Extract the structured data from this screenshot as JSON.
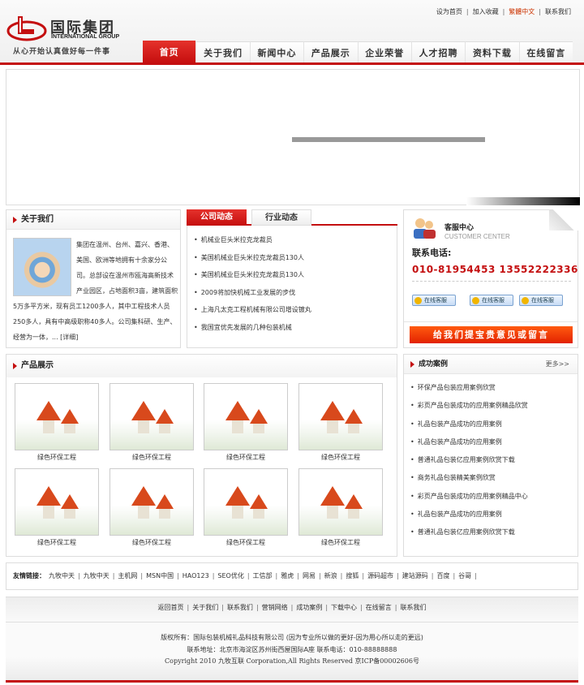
{
  "header": {
    "logo_cn": "国际集团",
    "logo_en": "INTERNATIONAL GROUP",
    "slogan": "从心开始认真做好每一件事",
    "top_links": [
      "设为首页",
      "加入收藏",
      "繁體中文",
      "联系我们"
    ],
    "nav": [
      "首页",
      "关于我们",
      "新闻中心",
      "产品展示",
      "企业荣誉",
      "人才招聘",
      "资料下载",
      "在线留言"
    ]
  },
  "about": {
    "title": "关于我们",
    "text": "集团在温州、台州、嘉兴、香港、美国、欧洲等地拥有十余家分公司。总部设在温州市瓯海高新技术产业园区，占地面积3亩，建筑面积5万多平方米，现有员工1200多人，其中工程技术人员250多人，具有中高级职称40多人。公司集科研、生产、经营为一体，... [详细]"
  },
  "news": {
    "tabs": [
      "公司动态",
      "行业动态"
    ],
    "items": [
      "机械业巨头米拉克龙裁员",
      "美国机械业巨头米拉克龙裁员130人",
      "美国机械业巨头米拉克龙裁员130人",
      "2009将加快机械工业发展的步伐",
      "上海凡太克工程机械有限公司增设镀丸",
      "我国宜优先发展的几种包装机械"
    ]
  },
  "service": {
    "title": "客服中心",
    "subtitle": "CUSTOMER CENTER",
    "tel_label": "联系电话:",
    "tel": "010-81954453   13552222336",
    "qq": [
      "在线客服",
      "在线客服",
      "在线客服"
    ],
    "feedback": "给我们提宝贵意见或留言"
  },
  "products": {
    "title": "产品展示",
    "items": [
      "绿色环保工程",
      "绿色环保工程",
      "绿色环保工程",
      "绿色环保工程",
      "绿色环保工程",
      "绿色环保工程",
      "绿色环保工程",
      "绿色环保工程"
    ]
  },
  "cases": {
    "title": "成功案例",
    "more": "更多>>",
    "items": [
      "环保产品包装应用案例欣赏",
      "彩页产品包装成功的应用案例精品欣赏",
      "礼品包装产品成功的应用案例",
      "礼品包装产品成功的应用案例",
      "普通礼品包装亿应用案例欣赏下载",
      "商务礼品包装精美案例欣赏",
      "彩页产品包装成功的应用案例精品中心",
      "礼品包装产品成功的应用案例",
      "普通礼品包装亿应用案例欣赏下载"
    ]
  },
  "links": {
    "label": "友情链接：",
    "items": [
      "九牧中天",
      "九牧中天",
      "主机网",
      "MSN中国",
      "HAO123",
      "SEO优化",
      "工信部",
      "雅虎",
      "网易",
      "新浪",
      "搜狐",
      "源码超市",
      "建站源码",
      "百度",
      "谷哥"
    ]
  },
  "footer": {
    "nav": [
      "返回首页",
      "关于我们",
      "联系我们",
      "营销网络",
      "成功案例",
      "下载中心",
      "在线留言",
      "联系我们"
    ],
    "line1": "版权所有：国际包装机械礼品科技有限公司 (因为专业所以做的更好-因为用心所以走的更远)",
    "line2": "联系地址：北京市海淀区苏州街西屋国际A座  联系电话：010-88888888",
    "line3": "Copyright 2010 九牧互联 Corporation,All Rights Reserved 京ICP备00002606号"
  },
  "colors": {
    "accent": "#c40f10",
    "feedback": "#ff4a0a"
  }
}
